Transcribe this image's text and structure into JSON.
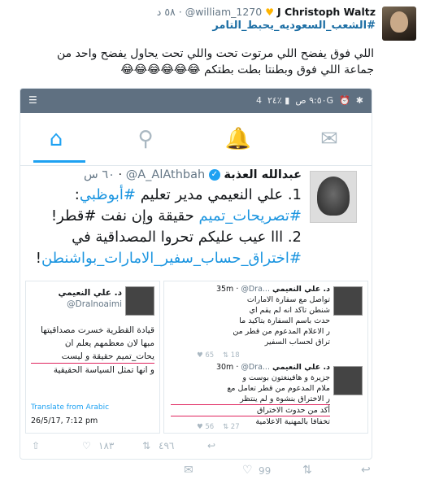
{
  "tweet": {
    "name": "J Christoph Waltz",
    "handle": "@william_1270",
    "time": "٥٨ د",
    "separator": "·",
    "hashtag": "#الشعب_السعوديه_يحبط_التامر",
    "body": "اللي فوق يفضح اللي مرتوت تحت واللي تحت يحاول يفضح واحد من جماعة اللي فوق وبطنتا بطت بطتكم 😂😂😂😂😂😂",
    "heart_icon": "yellow-heart-icon"
  },
  "screenshot": {
    "status_left": "٩:٥٠ ص",
    "status_right_text": "٪٢٤",
    "signal": "4G",
    "nav": [
      "home-icon",
      "search-icon",
      "bell-icon",
      "envelope-icon"
    ],
    "inner_tweet": {
      "name": "عبدالله العذبة",
      "handle": "@A_AlAthbah",
      "time": "٦٠ س",
      "lines": [
        {
          "text_before": "1. علي النعيمي مدير تعليم ",
          "hashtag": "#أبوظبي",
          "text_after": ":"
        },
        {
          "text_before": "",
          "hashtag": "#تصريحات_تميم",
          "text_after": " حقيقة وإن نفت #قطر!"
        },
        {
          "text_before": "2. ااا عيب عليكم تحروا المصداقية في",
          "hashtag": "",
          "text_after": ""
        },
        {
          "text_before": "",
          "hashtag": "#اختراق_حساب_سفير_الامارات_بواشنطن",
          "text_after": "!"
        }
      ]
    },
    "card_left": {
      "name": "د. علي النعيمي",
      "handle": "@Dralnoaimi",
      "body_lines": [
        "قيادة القطرية خسرت مصداقيتها",
        "مبها لان معظمهم يعلم ان",
        "يحات_تميم حقيقة و ليست",
        "و انها تمثل السياسة الحقيقية"
      ],
      "translate": "Translate from Arabic",
      "timestamp": "26/5/17, 7:12 pm"
    },
    "card_right": {
      "tweet1": {
        "name": "د. علي النعيمي",
        "handle": "@Dra...",
        "time": "35m",
        "lines": [
          "تواصل مع سفارة الامارات",
          "شنطن تاكد انه لم يقم اي",
          "حدث باسم السفارة بتاكيد ما",
          "ر الاعلام المدعوم من قطر من",
          "تراق لحساب السفير"
        ],
        "counts": [
          "65",
          "18"
        ]
      },
      "tweet2": {
        "name": "د. علي النعيمي",
        "handle": "@Dra...",
        "time": "30m",
        "lines": [
          "جزيرة و هافينغتون بوست و",
          "ملام المدعوم من قطر تعامل مع",
          "ر الاختراق بنشوة و لم ينتظر",
          "أكد من حدوث الاختراق",
          "تخفافا بالمهنية الاعلامية"
        ],
        "counts": [
          "56",
          "27"
        ]
      }
    },
    "actions": {
      "likes": "١٨٣",
      "retweets": "٤٩٦"
    }
  },
  "outer_actions": {
    "likes": "99"
  }
}
